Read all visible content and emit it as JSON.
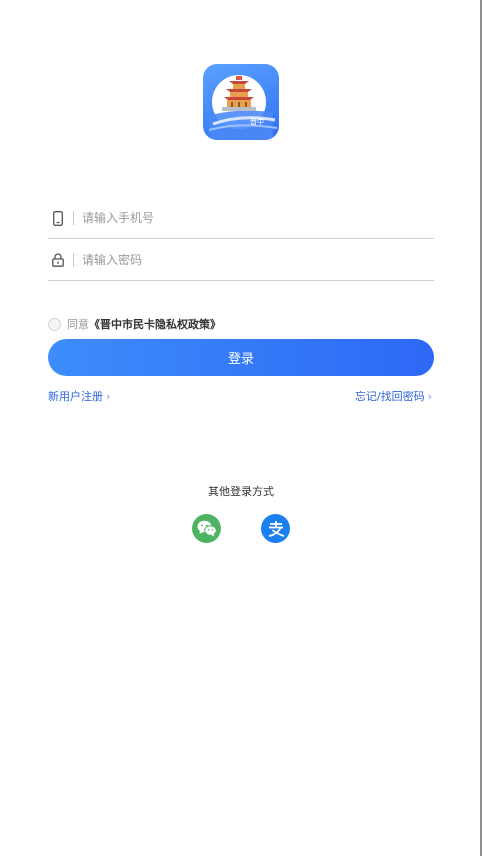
{
  "logo": {
    "caption": "晋中",
    "icon": "app-logo-pavilion"
  },
  "login_form": {
    "phone": {
      "placeholder": "请输入手机号",
      "value": "",
      "icon": "phone-icon"
    },
    "password": {
      "placeholder": "请输入密码",
      "value": "",
      "icon": "lock-icon"
    }
  },
  "agreement": {
    "prefix": "同意",
    "policy": "《晋中市民卡隐私权政策》"
  },
  "login_button": {
    "label": "登录"
  },
  "links": {
    "register": "新用户注册",
    "forgot": "忘记/找回密码"
  },
  "other_login": {
    "title": "其他登录方式",
    "methods": [
      {
        "icon": "wechat-icon"
      },
      {
        "icon": "alipay-icon"
      }
    ]
  },
  "colors": {
    "primary": "#2d68f5",
    "link": "#2c64d8",
    "wechat": "#4fb364",
    "alipay": "#1c7ff0"
  }
}
